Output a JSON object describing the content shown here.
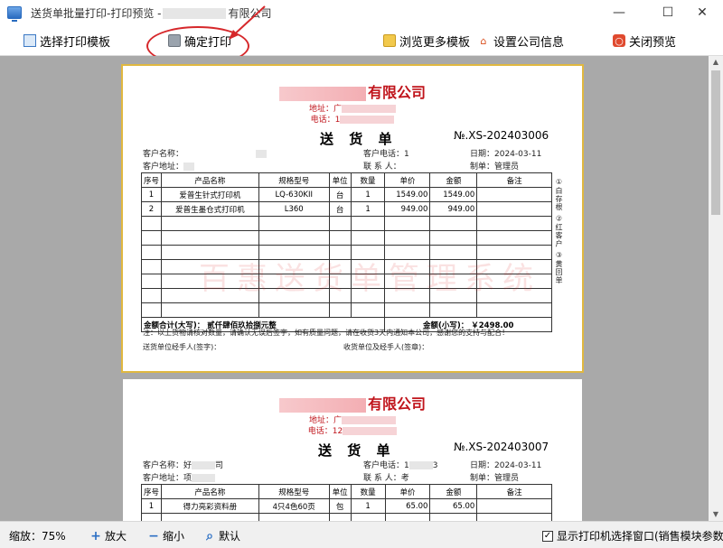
{
  "window": {
    "title_prefix": "送货单批量打印-打印预览 -",
    "title_suffix": "有限公司",
    "minimize": "—",
    "maximize": "☐",
    "close": "✕"
  },
  "toolbar": {
    "select_template": "选择打印模板",
    "confirm_print": "确定打印",
    "browse_templates": "浏览更多模板",
    "company_settings": "设置公司信息",
    "close_preview": "关闭预览"
  },
  "doc1": {
    "company_suffix": "有限公司",
    "address_label": "地址：广",
    "phone_label": "电话：1",
    "title": "送 货 单",
    "number": "№.XS-202403006",
    "customer_name_label": "客户名称：",
    "customer_addr_label": "客户地址：",
    "customer_phone_label": "客户电话：1",
    "contact_label": "联 系 人：",
    "date_label": "日期：2024-03-11",
    "maker_label": "制单：管理员",
    "headers": [
      "序号",
      "产品名称",
      "规格型号",
      "单位",
      "数量",
      "单价",
      "金额",
      "备注"
    ],
    "rows": [
      [
        "1",
        "爱普生针式打印机",
        "LQ-630KII",
        "台",
        "1",
        "1549.00",
        "1549.00",
        ""
      ],
      [
        "2",
        "爱普生墨仓式打印机",
        "L360",
        "台",
        "1",
        "949.00",
        "949.00",
        ""
      ]
    ],
    "total_upper": "金额合计(大写)： 贰仟肆佰玖拾捌元整",
    "total_lower": "金额(小写)： ￥2498.00",
    "side_note": "①白存根 ②红客户 ③黄回单",
    "note": "注：以上货物请核对数量，请确认无误后签字，如有质量问题，请在收货3天内通知本公司，感谢您的支持与配合！",
    "sender_sign": "送货单位经手人(签字)：",
    "receiver_sign": "收货单位及经手人(签章)："
  },
  "doc2": {
    "company_suffix": "有限公司",
    "address_label": "地址：广",
    "phone_label": "电话：12",
    "title": "送 货 单",
    "number": "№.XS-202403007",
    "customer_name_label": "客户名称：好",
    "customer_name_tail": "司",
    "customer_addr_label": "客户地址：项",
    "customer_phone_label": "客户电话：1",
    "customer_phone_tail": "3",
    "contact_label": "联 系 人：考",
    "date_label": "日期：2024-03-11",
    "maker_label": "制单：管理员",
    "headers": [
      "序号",
      "产品名称",
      "规格型号",
      "单位",
      "数量",
      "单价",
      "金额",
      "备注"
    ],
    "rows": [
      [
        "1",
        "得力亮彩资料册",
        "4只4色60页",
        "包",
        "1",
        "65.00",
        "65.00",
        ""
      ]
    ]
  },
  "watermark": "百惠送货单管理系统",
  "statusbar": {
    "zoom": "缩放：75%",
    "zoom_in": "放大",
    "zoom_out": "缩小",
    "default": "默认",
    "show_printer_dialog": "显示打印机选择窗口(销售模块参数"
  },
  "colors": {
    "accent_red": "#d6282b",
    "company_red": "#c0141b",
    "page_border": "#e0b840"
  }
}
